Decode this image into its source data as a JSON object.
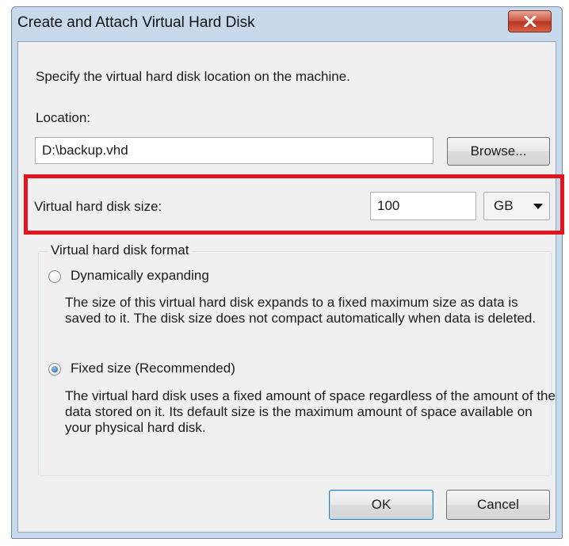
{
  "window": {
    "title": "Create and Attach Virtual Hard Disk"
  },
  "dialog": {
    "instruction": "Specify the virtual hard disk location on the machine.",
    "location_label": "Location:",
    "location_value": "D:\\backup.vhd",
    "browse_label": "Browse...",
    "size_label": "Virtual hard disk size:",
    "size_value": "100",
    "size_unit": "GB",
    "format_group_label": "Virtual hard disk format",
    "options": [
      {
        "label": "Dynamically expanding",
        "selected": false,
        "description": "The size of this virtual hard disk expands to a fixed maximum size as data is saved to it.  The disk size does not compact automatically when data is deleted."
      },
      {
        "label": "Fixed size (Recommended)",
        "selected": true,
        "description": "The virtual hard disk uses a fixed amount of space regardless of the amount of the data stored on it.  Its default size is the maximum amount of space available on your physical hard disk."
      }
    ],
    "ok_label": "OK",
    "cancel_label": "Cancel"
  },
  "icons": {
    "close": "close-icon",
    "dropdown": "chevron-down-icon",
    "radio_selected": "radio-selected-icon",
    "radio_unselected": "radio-unselected-icon"
  },
  "colors": {
    "highlight": "#e4141e",
    "title_bar": "#c9d9ec",
    "close_button": "#c9503b",
    "dialog_background": "#f0f0f0"
  }
}
